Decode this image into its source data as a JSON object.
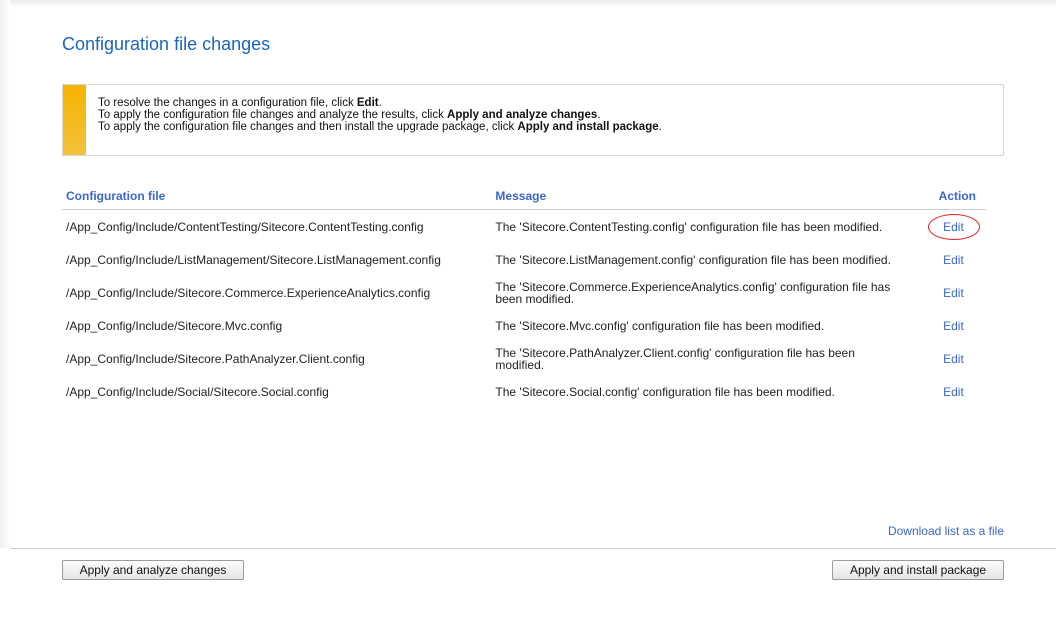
{
  "page": {
    "title": "Configuration file changes"
  },
  "info": {
    "lines": [
      {
        "prefix": "To resolve the changes in a configuration file, click ",
        "bold": "Edit",
        "suffix": "."
      },
      {
        "prefix": "To apply the configuration file changes and analyze the results, click ",
        "bold": "Apply and analyze changes",
        "suffix": "."
      },
      {
        "prefix": "To apply the configuration file changes and then install the upgrade package, click ",
        "bold": "Apply and install package",
        "suffix": "."
      }
    ],
    "accent_color": "#f5b400"
  },
  "table": {
    "headers": {
      "file": "Configuration file",
      "message": "Message",
      "action": "Action"
    },
    "rows": [
      {
        "file": "/App_Config/Include/ContentTesting/Sitecore.ContentTesting.config",
        "message": "The 'Sitecore.ContentTesting.config' configuration file has been modified.",
        "action": "Edit",
        "highlighted": true
      },
      {
        "file": "/App_Config/Include/ListManagement/Sitecore.ListManagement.config",
        "message": "The 'Sitecore.ListManagement.config' configuration file has been modified.",
        "action": "Edit",
        "highlighted": false
      },
      {
        "file": "/App_Config/Include/Sitecore.Commerce.ExperienceAnalytics.config",
        "message": "The 'Sitecore.Commerce.ExperienceAnalytics.config' configuration file has been modified.",
        "action": "Edit",
        "highlighted": false
      },
      {
        "file": "/App_Config/Include/Sitecore.Mvc.config",
        "message": "The 'Sitecore.Mvc.config' configuration file has been modified.",
        "action": "Edit",
        "highlighted": false
      },
      {
        "file": "/App_Config/Include/Sitecore.PathAnalyzer.Client.config",
        "message": "The 'Sitecore.PathAnalyzer.Client.config' configuration file has been modified.",
        "action": "Edit",
        "highlighted": false
      },
      {
        "file": "/App_Config/Include/Social/Sitecore.Social.config",
        "message": "The 'Sitecore.Social.config' configuration file has been modified.",
        "action": "Edit",
        "highlighted": false
      }
    ]
  },
  "download": {
    "label": "Download list as a file"
  },
  "buttons": {
    "analyze_label": "Apply and analyze changes",
    "install_label": "Apply and install package"
  },
  "colors": {
    "title": "#1a66b8",
    "link": "#3b67c7",
    "highlight_circle": "#e02020"
  }
}
